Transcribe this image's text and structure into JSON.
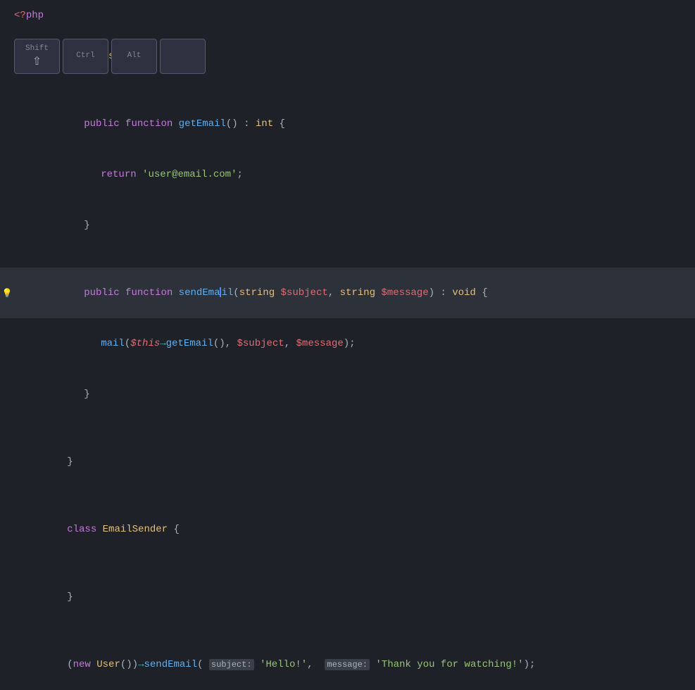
{
  "editor": {
    "php_open_tag": "<?php",
    "keyboard": {
      "keys": [
        {
          "label": "Shift",
          "icon": "⇧",
          "id": "shift"
        },
        {
          "label": "Ctrl",
          "icon": "",
          "id": "ctrl"
        },
        {
          "label": "Alt",
          "icon": "",
          "id": "alt"
        },
        {
          "label": "",
          "icon": "",
          "id": "extra"
        }
      ]
    },
    "lines": [
      {
        "indent": 0,
        "content": "class User {",
        "type": "class-open"
      },
      {
        "indent": 0,
        "content": "",
        "type": "empty"
      },
      {
        "indent": 2,
        "content": "public function getEmail() : int {",
        "type": "method"
      },
      {
        "indent": 3,
        "content": "return 'user@email.com';",
        "type": "return"
      },
      {
        "indent": 2,
        "content": "}",
        "type": "close"
      },
      {
        "indent": 0,
        "content": "",
        "type": "empty"
      },
      {
        "indent": 2,
        "content": "public function sendEmail(string $subject, string $message) : void {",
        "type": "method-highlighted",
        "highlight": true,
        "bulb": true
      },
      {
        "indent": 3,
        "content": "mail($this->getEmail(), $subject, $message);",
        "type": "mail-call"
      },
      {
        "indent": 2,
        "content": "}",
        "type": "close"
      },
      {
        "indent": 0,
        "content": "",
        "type": "empty"
      },
      {
        "indent": 0,
        "content": "}",
        "type": "close"
      },
      {
        "indent": 0,
        "content": "",
        "type": "empty"
      },
      {
        "indent": 0,
        "content": "class EmailSender {",
        "type": "class-open"
      },
      {
        "indent": 0,
        "content": "",
        "type": "empty"
      },
      {
        "indent": 0,
        "content": "}",
        "type": "close"
      },
      {
        "indent": 0,
        "content": "",
        "type": "empty"
      },
      {
        "indent": 0,
        "content": "(new User())->sendEmail( subject: 'Hello!',  message: 'Thank you for watching!');",
        "type": "call"
      }
    ]
  }
}
